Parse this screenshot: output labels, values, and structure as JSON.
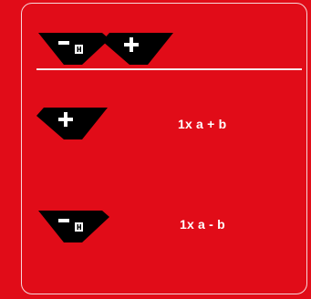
{
  "header": {
    "keys": [
      {
        "name": "minus-h-key",
        "icon": "minus-h-icon"
      },
      {
        "name": "plus-key",
        "icon": "plus-icon"
      }
    ]
  },
  "rows": [
    {
      "key_icon": "plus-icon",
      "formula": "1x a + b"
    },
    {
      "key_icon": "minus-h-icon",
      "formula": "1x a - b"
    }
  ],
  "colors": {
    "background": "#e10c18",
    "key": "#000000",
    "text": "#ffffff",
    "divider": "#f8e6e8"
  }
}
